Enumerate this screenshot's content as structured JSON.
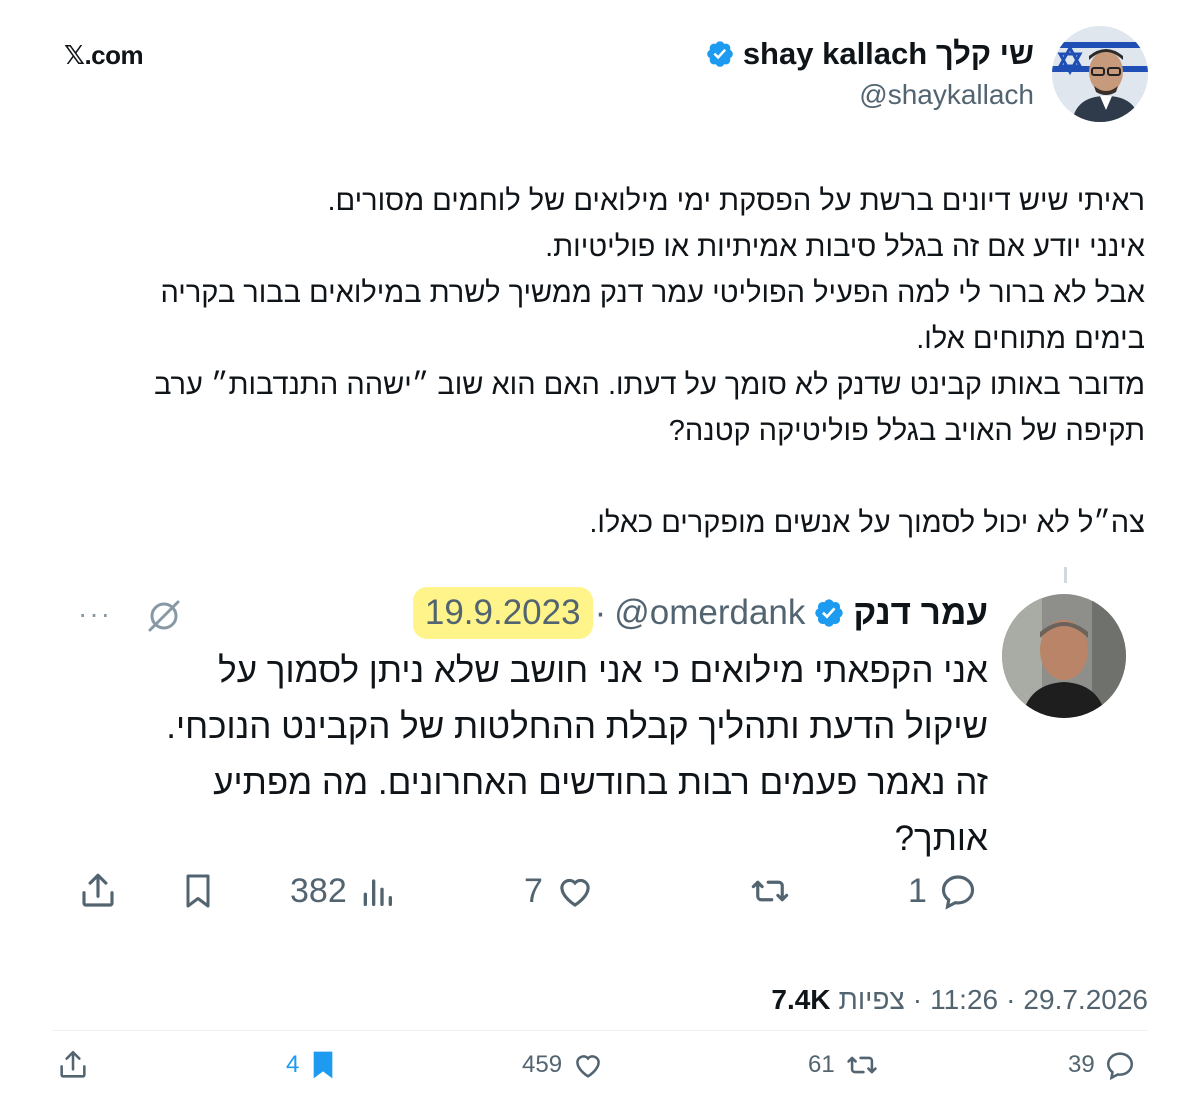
{
  "site": {
    "label": "𝕏.com"
  },
  "author": {
    "name": "shay kallach שי קלך",
    "handle": "@shaykallach",
    "verified": true
  },
  "tweet": {
    "paragraphs": [
      "ראיתי שיש דיונים ברשת על הפסקת ימי מילואים של לוחמים מסורים.",
      "אינני יודע אם זה בגלל סיבות אמיתיות או פוליטיות.",
      "אבל לא ברור לי למה הפעיל הפוליטי עמר דנק ממשיך לשרת במילואים בבור בקריה בימים מתוחים אלו.",
      "מדובר באותו קבינט שדנק לא סומך על דעתו. האם הוא שוב ״ישהה התנדבות״ ערב תקיפה של האויב בגלל פוליטיקה קטנה?",
      "",
      "צה״ל לא יכול לסמוך על אנשים מופקרים כאלו."
    ]
  },
  "quoted": {
    "name": "עמר דנק",
    "handle": "@omerdank",
    "dot": "·",
    "date": "19.9.2023",
    "highlight_color": "#fff48a",
    "lines": [
      "אני הקפאתי מילואים כי אני חושב שלא ניתן לסמוך על",
      "שיקול הדעת ותהליך קבלת ההחלטות של הקבינט הנוכחי.",
      "זה נאמר פעמים רבות בחודשים האחרונים. מה מפתיע",
      "אותך?"
    ],
    "more": "···",
    "actions": {
      "replies": "1",
      "likes": "7",
      "views": "382"
    }
  },
  "meta": {
    "date": "29.7.2026",
    "sep1": "·",
    "time": "11:26",
    "sep2": "·",
    "views_label": "צפיות",
    "views_count": "7.4K"
  },
  "actions": {
    "replies": "39",
    "reposts": "61",
    "likes": "459",
    "bookmarks": "4"
  },
  "colors": {
    "text": "#0f1419",
    "secondary": "#536471",
    "verified": "#1d9bf0",
    "bookmark_active": "#1d9bf0"
  }
}
